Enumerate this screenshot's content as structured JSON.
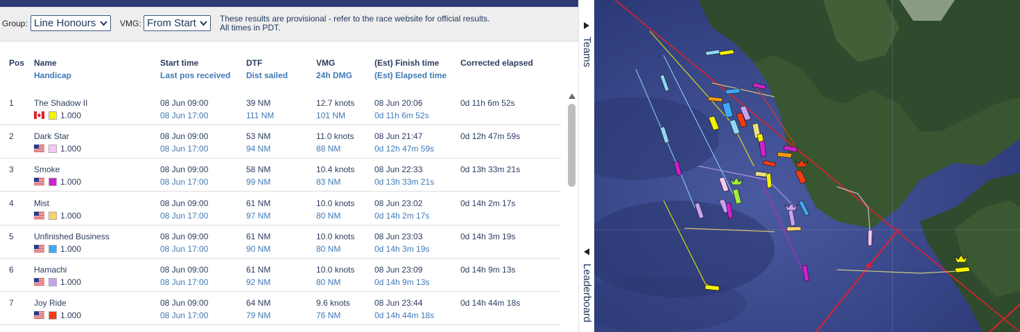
{
  "controls": {
    "group_label": "Group:",
    "group_value": "Line Honours",
    "vmg_label": "VMG:",
    "vmg_value": "From Start",
    "notice_line1": "These results are provisional - refer to the race website for official results.",
    "notice_line2": "All times in PDT."
  },
  "headers": {
    "pos": "Pos",
    "name": "Name",
    "handicap": "Handicap",
    "start_time": "Start time",
    "last_pos": "Last pos received",
    "dtf": "DTF",
    "dist_sailed": "Dist sailed",
    "vmg": "VMG",
    "dmg": "24h DMG",
    "finish": "(Est) Finish time",
    "elapsed": "(Est) Elapsed time",
    "corrected": "Corrected elapsed"
  },
  "rows": [
    {
      "pos": "1",
      "name": "The Shadow II",
      "flag": "CA",
      "color": "#f5f200",
      "handicap": "1.000",
      "start": "08 Jun 09:00",
      "last_pos": "08 Jun 17:00",
      "dtf": "39 NM",
      "sailed": "111 NM",
      "vmg": "12.7 knots",
      "dmg": "101 NM",
      "finish": "08 Jun 20:06",
      "elapsed": "0d 11h 6m 52s",
      "corrected": "0d 11h 6m 52s"
    },
    {
      "pos": "2",
      "name": "Dark Star",
      "flag": "US",
      "color": "#f6c8f2",
      "handicap": "1.000",
      "start": "08 Jun 09:00",
      "last_pos": "08 Jun 17:00",
      "dtf": "53 NM",
      "sailed": "94 NM",
      "vmg": "11.0 knots",
      "dmg": "88 NM",
      "finish": "08 Jun 21:47",
      "elapsed": "0d 12h 47m 59s",
      "corrected": "0d 12h 47m 59s"
    },
    {
      "pos": "3",
      "name": "Smoke",
      "flag": "US",
      "color": "#d020d0",
      "handicap": "1.000",
      "start": "08 Jun 09:00",
      "last_pos": "08 Jun 17:00",
      "dtf": "58 NM",
      "sailed": "99 NM",
      "vmg": "10.4 knots",
      "dmg": "83 NM",
      "finish": "08 Jun 22:33",
      "elapsed": "0d 13h 33m 21s",
      "corrected": "0d 13h 33m 21s"
    },
    {
      "pos": "4",
      "name": "Mist",
      "flag": "US",
      "color": "#f7d070",
      "handicap": "1.000",
      "start": "08 Jun 09:00",
      "last_pos": "08 Jun 17:00",
      "dtf": "61 NM",
      "sailed": "97 NM",
      "vmg": "10.0 knots",
      "dmg": "80 NM",
      "finish": "08 Jun 23:02",
      "elapsed": "0d 14h 2m 17s",
      "corrected": "0d 14h 2m 17s"
    },
    {
      "pos": "5",
      "name": "Unfinished Business",
      "flag": "US",
      "color": "#3fa9f5",
      "handicap": "1.000",
      "start": "08 Jun 09:00",
      "last_pos": "08 Jun 17:00",
      "dtf": "61 NM",
      "sailed": "90 NM",
      "vmg": "10.0 knots",
      "dmg": "80 NM",
      "finish": "08 Jun 23:03",
      "elapsed": "0d 14h 3m 19s",
      "corrected": "0d 14h 3m 19s"
    },
    {
      "pos": "6",
      "name": "Hamachi",
      "flag": "US",
      "color": "#c9a2f2",
      "handicap": "1.000",
      "start": "08 Jun 09:00",
      "last_pos": "08 Jun 17:00",
      "dtf": "61 NM",
      "sailed": "92 NM",
      "vmg": "10.0 knots",
      "dmg": "80 NM",
      "finish": "08 Jun 23:09",
      "elapsed": "0d 14h 9m 13s",
      "corrected": "0d 14h 9m 13s"
    },
    {
      "pos": "7",
      "name": "Joy Ride",
      "flag": "US",
      "color": "#f23a10",
      "handicap": "1.000",
      "start": "08 Jun 09:00",
      "last_pos": "08 Jun 17:00",
      "dtf": "64 NM",
      "sailed": "79 NM",
      "vmg": "9.6 knots",
      "dmg": "76 NM",
      "finish": "08 Jun 23:44",
      "elapsed": "0d 14h 44m 18s",
      "corrected": "0d 14h 44m 18s"
    }
  ],
  "sidebar": {
    "teams_label": "Teams",
    "leaderboard_label": "Leaderboard"
  },
  "icons": {
    "group_dropdown": "chevron-down-icon",
    "vmg_dropdown": "chevron-down-icon",
    "teams_toggle": "triangle-right-icon",
    "leaderboard_toggle": "triangle-left-icon",
    "scroll_up": "triangle-up-icon"
  }
}
